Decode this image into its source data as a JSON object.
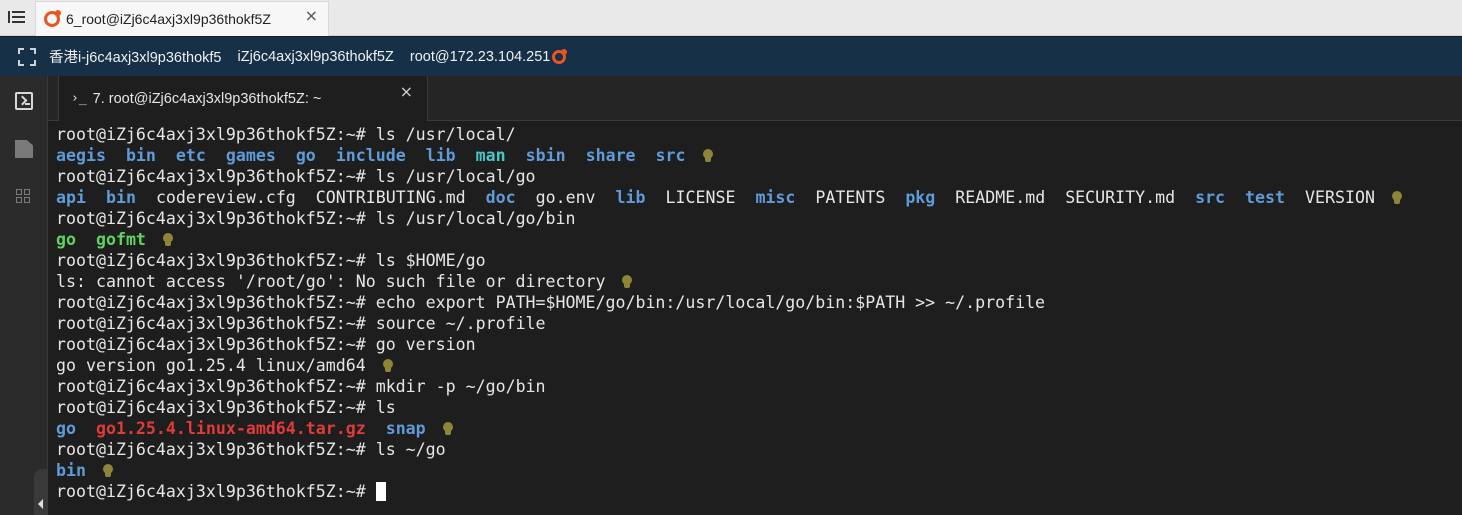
{
  "window": {
    "session_tab_label": "6_root@iZj6c4axj3xl9p36thokf5Z",
    "session_tab_close": "×"
  },
  "hostbar": {
    "host_name": "香港i-j6c4axj3xl9p36thokf5",
    "instance_id": "iZj6c4axj3xl9p36thokf5Z",
    "user_host": "root@172.23.104.251"
  },
  "terminal_tab": {
    "prompt_glyph": "›_",
    "label": "7. root@iZj6c4axj3xl9p36thokf5Z: ~",
    "close": "×"
  },
  "prompt": "root@iZj6c4axj3xl9p36thokf5Z:~# ",
  "commands": {
    "c1": "ls /usr/local/",
    "c2": "ls /usr/local/go",
    "c3": "ls /usr/local/go/bin",
    "c4": "ls $HOME/go",
    "c5": "echo export PATH=$HOME/go/bin:/usr/local/go/bin:$PATH >> ~/.profile",
    "c6": "source ~/.profile",
    "c7": "go version",
    "c8": "mkdir -p ~/go/bin",
    "c9": "ls",
    "c10": "ls ~/go"
  },
  "outputs": {
    "usr_local": [
      "aegis",
      "bin",
      "etc",
      "games",
      "go",
      "include",
      "lib",
      "man",
      "sbin",
      "share",
      "src"
    ],
    "usr_local_go": [
      "api",
      "bin",
      "codereview.cfg",
      "CONTRIBUTING.md",
      "doc",
      "go.env",
      "lib",
      "LICENSE",
      "misc",
      "PATENTS",
      "pkg",
      "README.md",
      "SECURITY.md",
      "src",
      "test",
      "VERSION"
    ],
    "go_bin": [
      "go",
      "gofmt"
    ],
    "ls_error": "ls: cannot access '/root/go': No such file or directory",
    "go_version": "go version go1.25.4 linux/amd64",
    "home_ls": [
      "go",
      "go1.25.4.linux-amd64.tar.gz",
      "snap"
    ],
    "home_go": [
      "bin"
    ]
  },
  "colors": {
    "directory": "#5f9bd8",
    "executable": "#5fd35f",
    "man_dir": "#43c7c9",
    "archive": "#e03a3a",
    "plain": "#e6e6e6",
    "hint_bulb": "#8d8537",
    "hostbar_bg": "#163047",
    "terminal_bg": "#1e1e1e"
  },
  "icons": [
    "menu-icon",
    "ubuntu-logo-icon",
    "expand-icon",
    "terminal-icon",
    "file-icon",
    "grid-icon",
    "lightbulb-icon",
    "close-icon"
  ]
}
